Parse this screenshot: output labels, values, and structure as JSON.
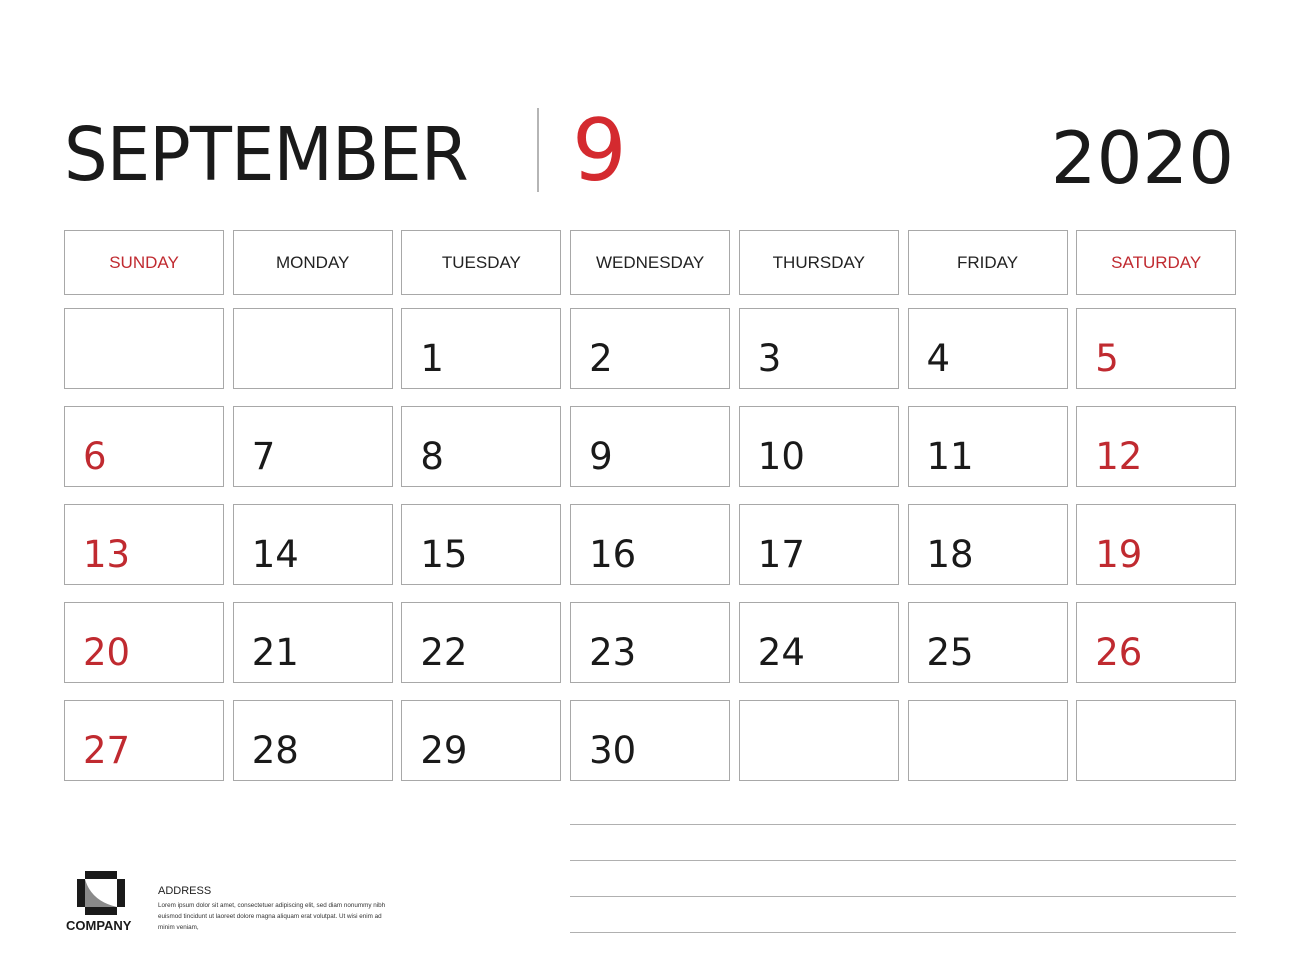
{
  "header": {
    "month_name": "SEPTEMBER",
    "month_number": "9",
    "year": "2020"
  },
  "colors": {
    "accent_red": "#c02a30",
    "text_dark": "#1a1a1a",
    "border_gray": "#a8a8a8"
  },
  "weekdays": [
    {
      "label": "SUNDAY",
      "weekend": true
    },
    {
      "label": "MONDAY",
      "weekend": false
    },
    {
      "label": "TUESDAY",
      "weekend": false
    },
    {
      "label": "WEDNESDAY",
      "weekend": false
    },
    {
      "label": "THURSDAY",
      "weekend": false
    },
    {
      "label": "FRIDAY",
      "weekend": false
    },
    {
      "label": "SATURDAY",
      "weekend": true
    }
  ],
  "weeks": [
    [
      "",
      "",
      "1",
      "2",
      "3",
      "4",
      "5"
    ],
    [
      "6",
      "7",
      "8",
      "9",
      "10",
      "11",
      "12"
    ],
    [
      "13",
      "14",
      "15",
      "16",
      "17",
      "18",
      "19"
    ],
    [
      "20",
      "21",
      "22",
      "23",
      "24",
      "25",
      "26"
    ],
    [
      "27",
      "28",
      "29",
      "30",
      "",
      "",
      ""
    ]
  ],
  "notes": {
    "line_count": 4
  },
  "footer": {
    "company_name": "COMPANY",
    "logo_icon": "company-logo-icon",
    "address_title": "ADDRESS",
    "address_body": "Lorem ipsum dolor sit amet, consectetuer adipiscing elit, sed diam nonummy nibh euismod tincidunt ut laoreet dolore magna aliquam erat volutpat. Ut wisi enim ad minim veniam,"
  }
}
